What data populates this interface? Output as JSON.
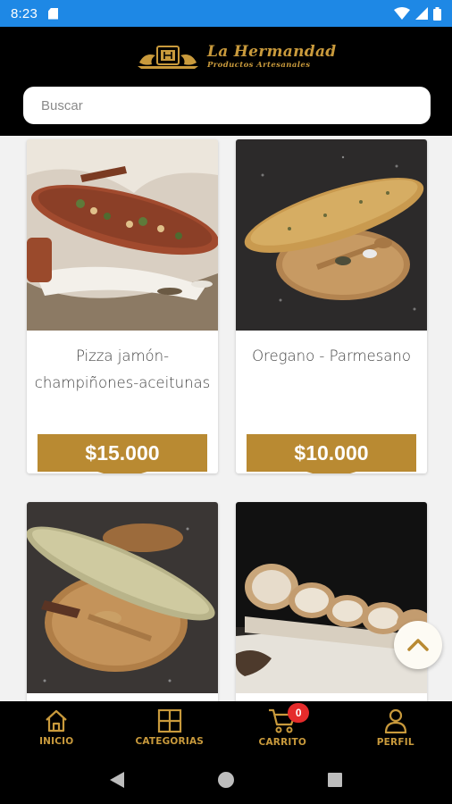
{
  "status_bar": {
    "time": "8:23"
  },
  "header": {
    "brand_title": "La Hermandad",
    "brand_subtitle": "Productos Artesanales"
  },
  "search": {
    "placeholder": "Buscar",
    "value": ""
  },
  "products": [
    {
      "name": "Pizza jamón-champiñones-aceitunas",
      "price": "$15.000"
    },
    {
      "name": "Oregano - Parmesano",
      "price": "$10.000"
    },
    {
      "name": "",
      "price": ""
    },
    {
      "name": "",
      "price": ""
    }
  ],
  "bottom_nav": {
    "items": [
      {
        "label": "INICIO",
        "icon": "home-icon"
      },
      {
        "label": "CATEGORIAS",
        "icon": "grid-icon"
      },
      {
        "label": "CARRITO",
        "icon": "cart-icon"
      },
      {
        "label": "PERFIL",
        "icon": "user-icon"
      }
    ],
    "cart_count": "0"
  },
  "colors": {
    "accent_gold": "#b98a32",
    "nav_gold": "#c99a3c",
    "status_bar": "#1e88e5",
    "badge_red": "#e52b2b"
  }
}
